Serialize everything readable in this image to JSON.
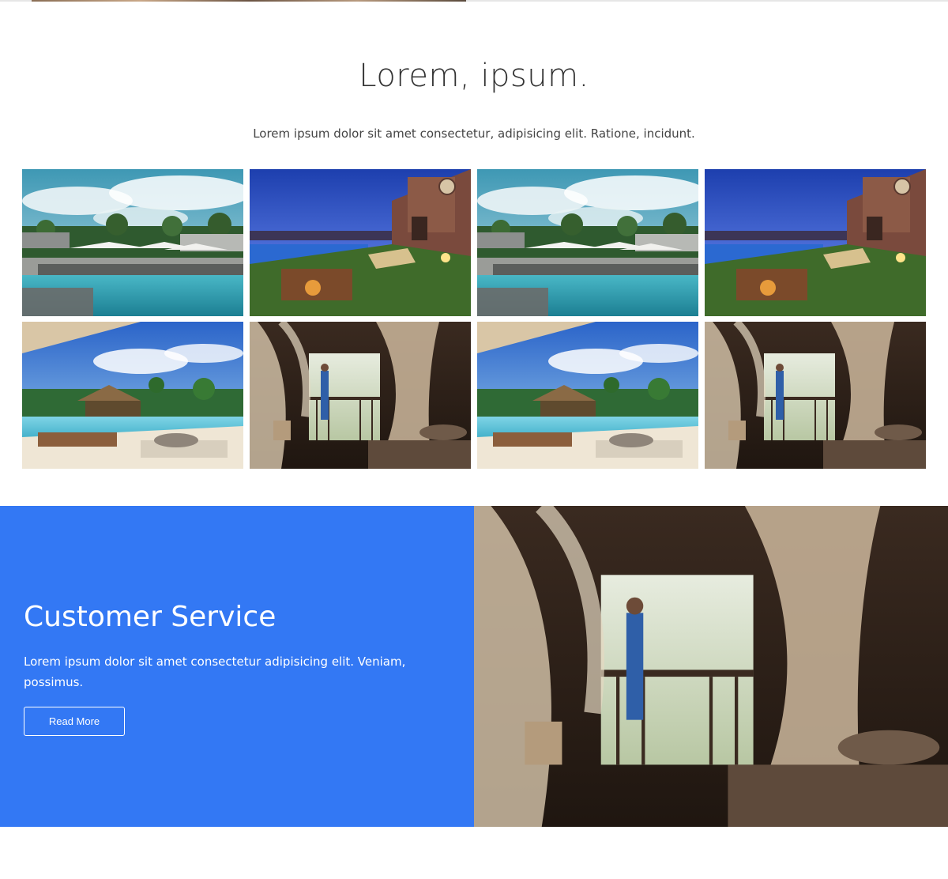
{
  "gallery": {
    "title": "Lorem, ipsum.",
    "subtitle": "Lorem ipsum dolor sit amet consectetur, adipisicing elit. Ratione, incidunt.",
    "images": [
      {
        "scene": "pool-day"
      },
      {
        "scene": "pool-dusk"
      },
      {
        "scene": "pool-day"
      },
      {
        "scene": "pool-dusk"
      },
      {
        "scene": "pool-tropical"
      },
      {
        "scene": "bedroom-canopy"
      },
      {
        "scene": "pool-tropical"
      },
      {
        "scene": "bedroom-canopy"
      }
    ]
  },
  "promo": {
    "title": "Customer Service",
    "text": "Lorem ipsum dolor sit amet consectetur adipisicing elit. Veniam, possimus.",
    "button_label": "Read More",
    "image_scene": "bedroom-canopy",
    "accent_color": "#3378f4"
  }
}
